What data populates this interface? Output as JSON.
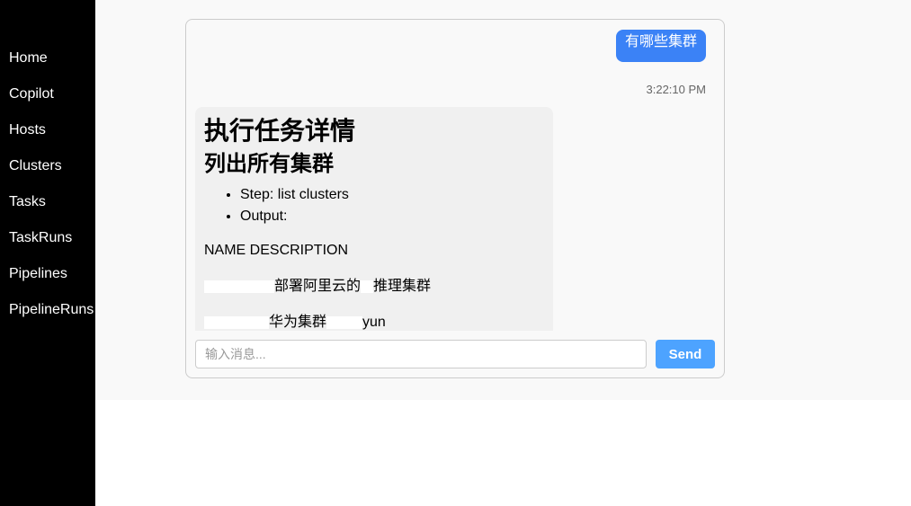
{
  "sidebar": {
    "items": [
      {
        "label": "Home"
      },
      {
        "label": "Copilot"
      },
      {
        "label": "Hosts"
      },
      {
        "label": "Clusters"
      },
      {
        "label": "Tasks"
      },
      {
        "label": "TaskRuns"
      },
      {
        "label": "Pipelines"
      },
      {
        "label": "PipelineRuns"
      }
    ]
  },
  "chat": {
    "user_message": "有哪些集群",
    "timestamp": "3:22:10 PM",
    "bot_message": {
      "heading1": "执行任务详情",
      "heading2": "列出所有集群",
      "bullets": [
        "Step: list clusters",
        "Output:"
      ],
      "table_header": "NAME DESCRIPTION",
      "row1": "部署阿里云的",
      "row1_suffix": "推理集群",
      "row2": "华为集群",
      "row2_suffix": "yun"
    },
    "input_placeholder": "输入消息...",
    "send_label": "Send"
  },
  "colors": {
    "sidebar_bg": "#000000",
    "user_bubble": "#3b82f6",
    "send_button": "#4da3ff",
    "bot_bubble": "#f0f0f0"
  }
}
